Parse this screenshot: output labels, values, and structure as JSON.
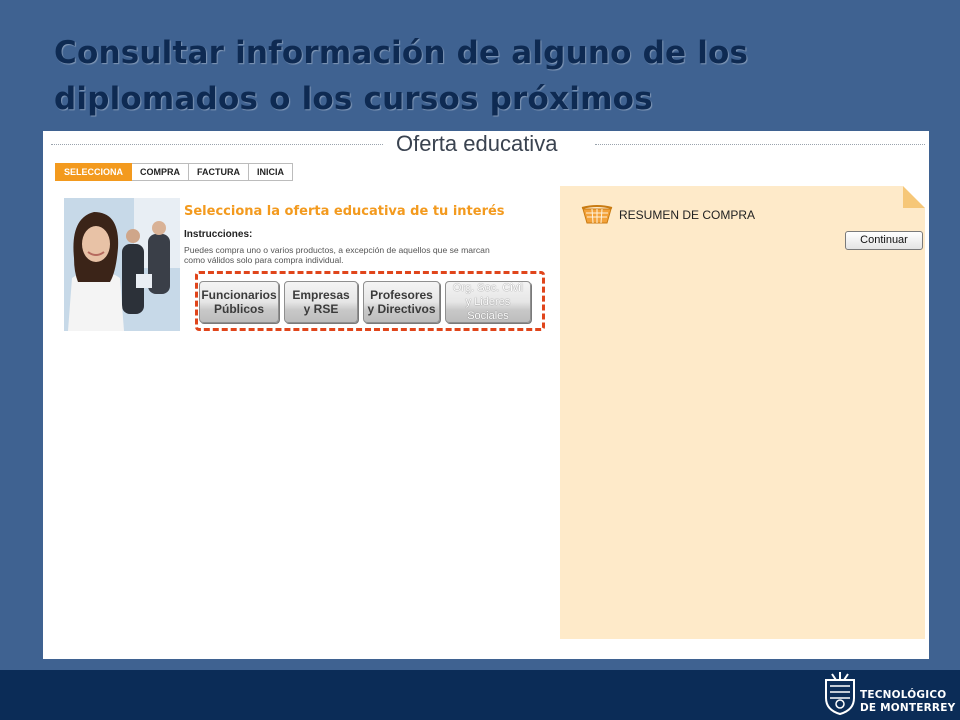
{
  "slide": {
    "title_line1": "Consultar información de alguno de los",
    "title_line2": "diplomados o los cursos próximos"
  },
  "page": {
    "header_title": "Oferta educativa",
    "steps": [
      {
        "label": "SELECCIONA",
        "active": true
      },
      {
        "label": "COMPRA",
        "active": false
      },
      {
        "label": "FACTURA",
        "active": false
      },
      {
        "label": "INICIA",
        "active": false
      }
    ],
    "heading": "Selecciona la oferta educativa de tu interés",
    "instructions_label": "Instrucciones:",
    "instructions_line1": "Puedes compra uno o varios productos, a excepción de aquellos que se marcan",
    "instructions_line2": "como válidos solo para compra individual.",
    "categories": [
      {
        "line1": "Funcionarios",
        "line2": "Públicos"
      },
      {
        "line1": "Empresas",
        "line2": "y RSE"
      },
      {
        "line1": "Profesores",
        "line2": "y Directivos"
      },
      {
        "line1": "Org. Soc. Civil",
        "line2": "y Lideres Sociales"
      }
    ]
  },
  "summary": {
    "title": "RESUMEN DE COMPRA",
    "continue_label": "Continuar"
  },
  "footer": {
    "logo_line1": "TECNOLÓGICO",
    "logo_line2": "DE MONTERREY"
  },
  "colors": {
    "slide_bg": "#3f6291",
    "title": "#0e2a52",
    "accent_orange": "#f39a1e",
    "highlight_dash": "#e0451b",
    "summary_bg": "#feeac9",
    "footer_bg": "#0b2c57"
  }
}
